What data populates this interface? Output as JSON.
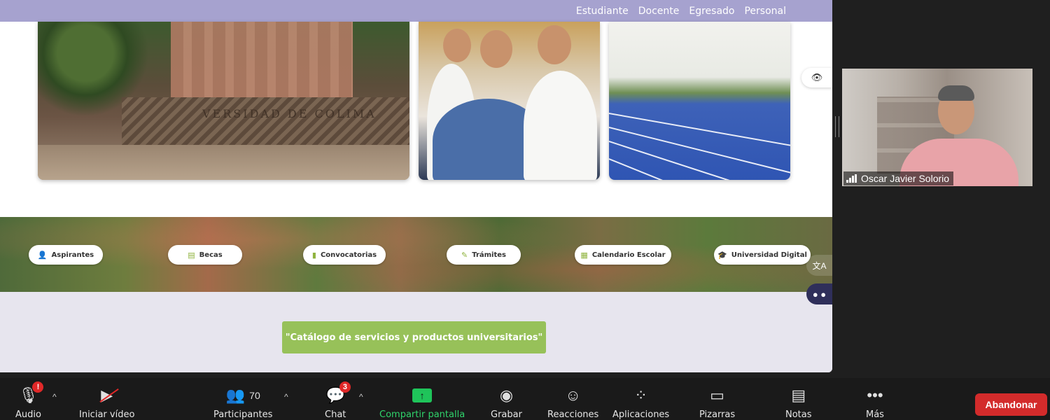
{
  "website": {
    "topnav": [
      "Estudiante",
      "Docente",
      "Egresado",
      "Personal"
    ],
    "photo_inscription": "VERSIDAD DE COLIMA",
    "quick_links": [
      {
        "label": "Aspirantes",
        "icon": "user-icon"
      },
      {
        "label": "Becas",
        "icon": "document-icon"
      },
      {
        "label": "Convocatorias",
        "icon": "file-icon"
      },
      {
        "label": "Trámites",
        "icon": "pencil-icon"
      },
      {
        "label": "Calendario Escolar",
        "icon": "calendar-icon"
      },
      {
        "label": "Universidad Digital",
        "icon": "graduation-cap-icon"
      }
    ],
    "catalog_button": "\"Catálogo de servicios y productos universitarios\"",
    "accent_color": "#97c159",
    "nav_color": "#a6a2cf"
  },
  "video": {
    "participant_name": "Oscar Javier Solorio"
  },
  "toolbar": {
    "audio": {
      "label": "Audio",
      "badge": "!"
    },
    "video": {
      "label": "Iniciar vídeo"
    },
    "participants": {
      "label": "Participantes",
      "count": "70"
    },
    "chat": {
      "label": "Chat",
      "badge": "3"
    },
    "share": {
      "label": "Compartir pantalla"
    },
    "record": {
      "label": "Grabar"
    },
    "reactions": {
      "label": "Reacciones"
    },
    "apps": {
      "label": "Aplicaciones"
    },
    "whiteboards": {
      "label": "Pizarras"
    },
    "notes": {
      "label": "Notas"
    },
    "more": {
      "label": "Más"
    },
    "leave": {
      "label": "Abandonar"
    }
  }
}
